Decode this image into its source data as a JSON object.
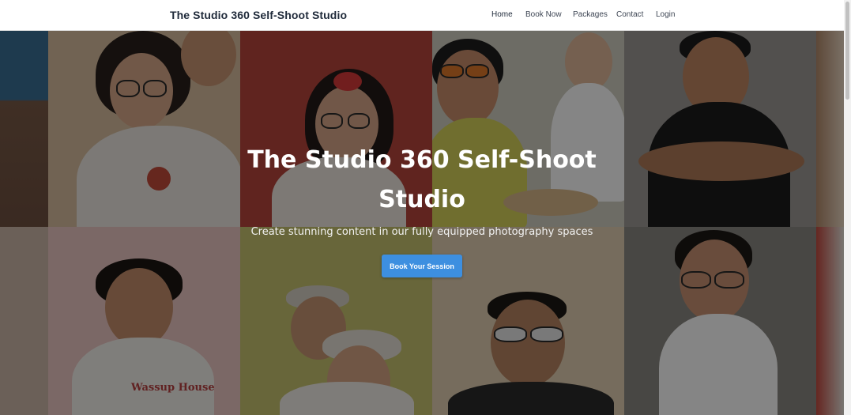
{
  "header": {
    "brand": "The Studio 360 Self-Shoot Studio",
    "nav": [
      {
        "label": "Home",
        "active": true
      },
      {
        "label": "Book Now",
        "active": false
      },
      {
        "label": "Packages",
        "active": false
      },
      {
        "label": "Contact",
        "active": false
      },
      {
        "label": "Login",
        "active": false
      }
    ]
  },
  "hero": {
    "title": "The Studio 360 Self-Shoot Studio",
    "subtitle": "Create stunning content in our fully equipped photography spaces",
    "cta_label": "Book Your Session",
    "photo_caption_text": "Wassup House"
  },
  "colors": {
    "accent": "#3d8fe0",
    "brand_text": "#1f2a3a",
    "overlay": "rgba(0,0,0,0.48)"
  }
}
